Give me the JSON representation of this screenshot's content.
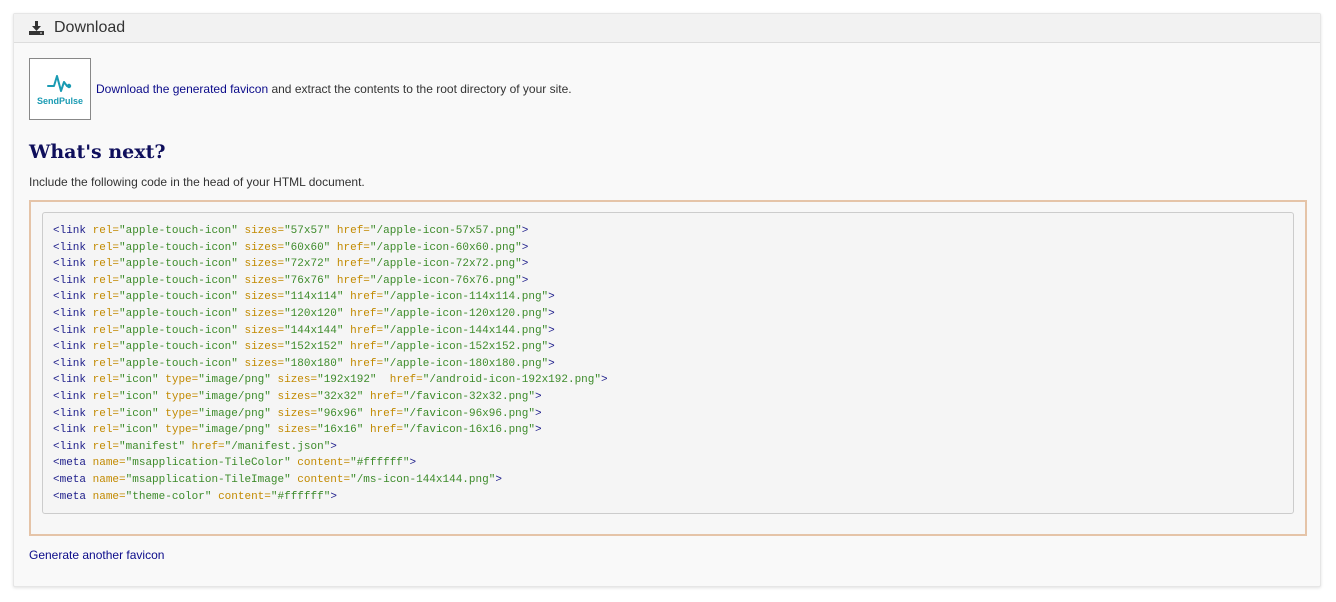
{
  "panel": {
    "title": "Download",
    "download_icon": "download-icon"
  },
  "favicon": {
    "brand": "SendPulse",
    "icon": "pulse-logo-icon",
    "brand_color": "#1a9bb3"
  },
  "download": {
    "link_text": "Download the generated favicon",
    "suffix_text": " and extract the contents to the root directory of your site."
  },
  "heading": "What's next?",
  "intro": "Include the following code in the head of your HTML document.",
  "code_lines": [
    "<link rel=\"apple-touch-icon\" sizes=\"57x57\" href=\"/apple-icon-57x57.png\">",
    "<link rel=\"apple-touch-icon\" sizes=\"60x60\" href=\"/apple-icon-60x60.png\">",
    "<link rel=\"apple-touch-icon\" sizes=\"72x72\" href=\"/apple-icon-72x72.png\">",
    "<link rel=\"apple-touch-icon\" sizes=\"76x76\" href=\"/apple-icon-76x76.png\">",
    "<link rel=\"apple-touch-icon\" sizes=\"114x114\" href=\"/apple-icon-114x114.png\">",
    "<link rel=\"apple-touch-icon\" sizes=\"120x120\" href=\"/apple-icon-120x120.png\">",
    "<link rel=\"apple-touch-icon\" sizes=\"144x144\" href=\"/apple-icon-144x144.png\">",
    "<link rel=\"apple-touch-icon\" sizes=\"152x152\" href=\"/apple-icon-152x152.png\">",
    "<link rel=\"apple-touch-icon\" sizes=\"180x180\" href=\"/apple-icon-180x180.png\">",
    "<link rel=\"icon\" type=\"image/png\" sizes=\"192x192\"  href=\"/android-icon-192x192.png\">",
    "<link rel=\"icon\" type=\"image/png\" sizes=\"32x32\" href=\"/favicon-32x32.png\">",
    "<link rel=\"icon\" type=\"image/png\" sizes=\"96x96\" href=\"/favicon-96x96.png\">",
    "<link rel=\"icon\" type=\"image/png\" sizes=\"16x16\" href=\"/favicon-16x16.png\">",
    "<link rel=\"manifest\" href=\"/manifest.json\">",
    "<meta name=\"msapplication-TileColor\" content=\"#ffffff\">",
    "<meta name=\"msapplication-TileImage\" content=\"/ms-icon-144x144.png\">",
    "<meta name=\"theme-color\" content=\"#ffffff\">"
  ],
  "generate_link": "Generate another favicon",
  "colors": {
    "link": "#0b0b8a",
    "heading": "#0f0f5c",
    "code_tag": "#1c1c8a",
    "code_attr": "#c28a00",
    "code_value": "#3d8b2a",
    "code_border": "#e5c4a8"
  }
}
